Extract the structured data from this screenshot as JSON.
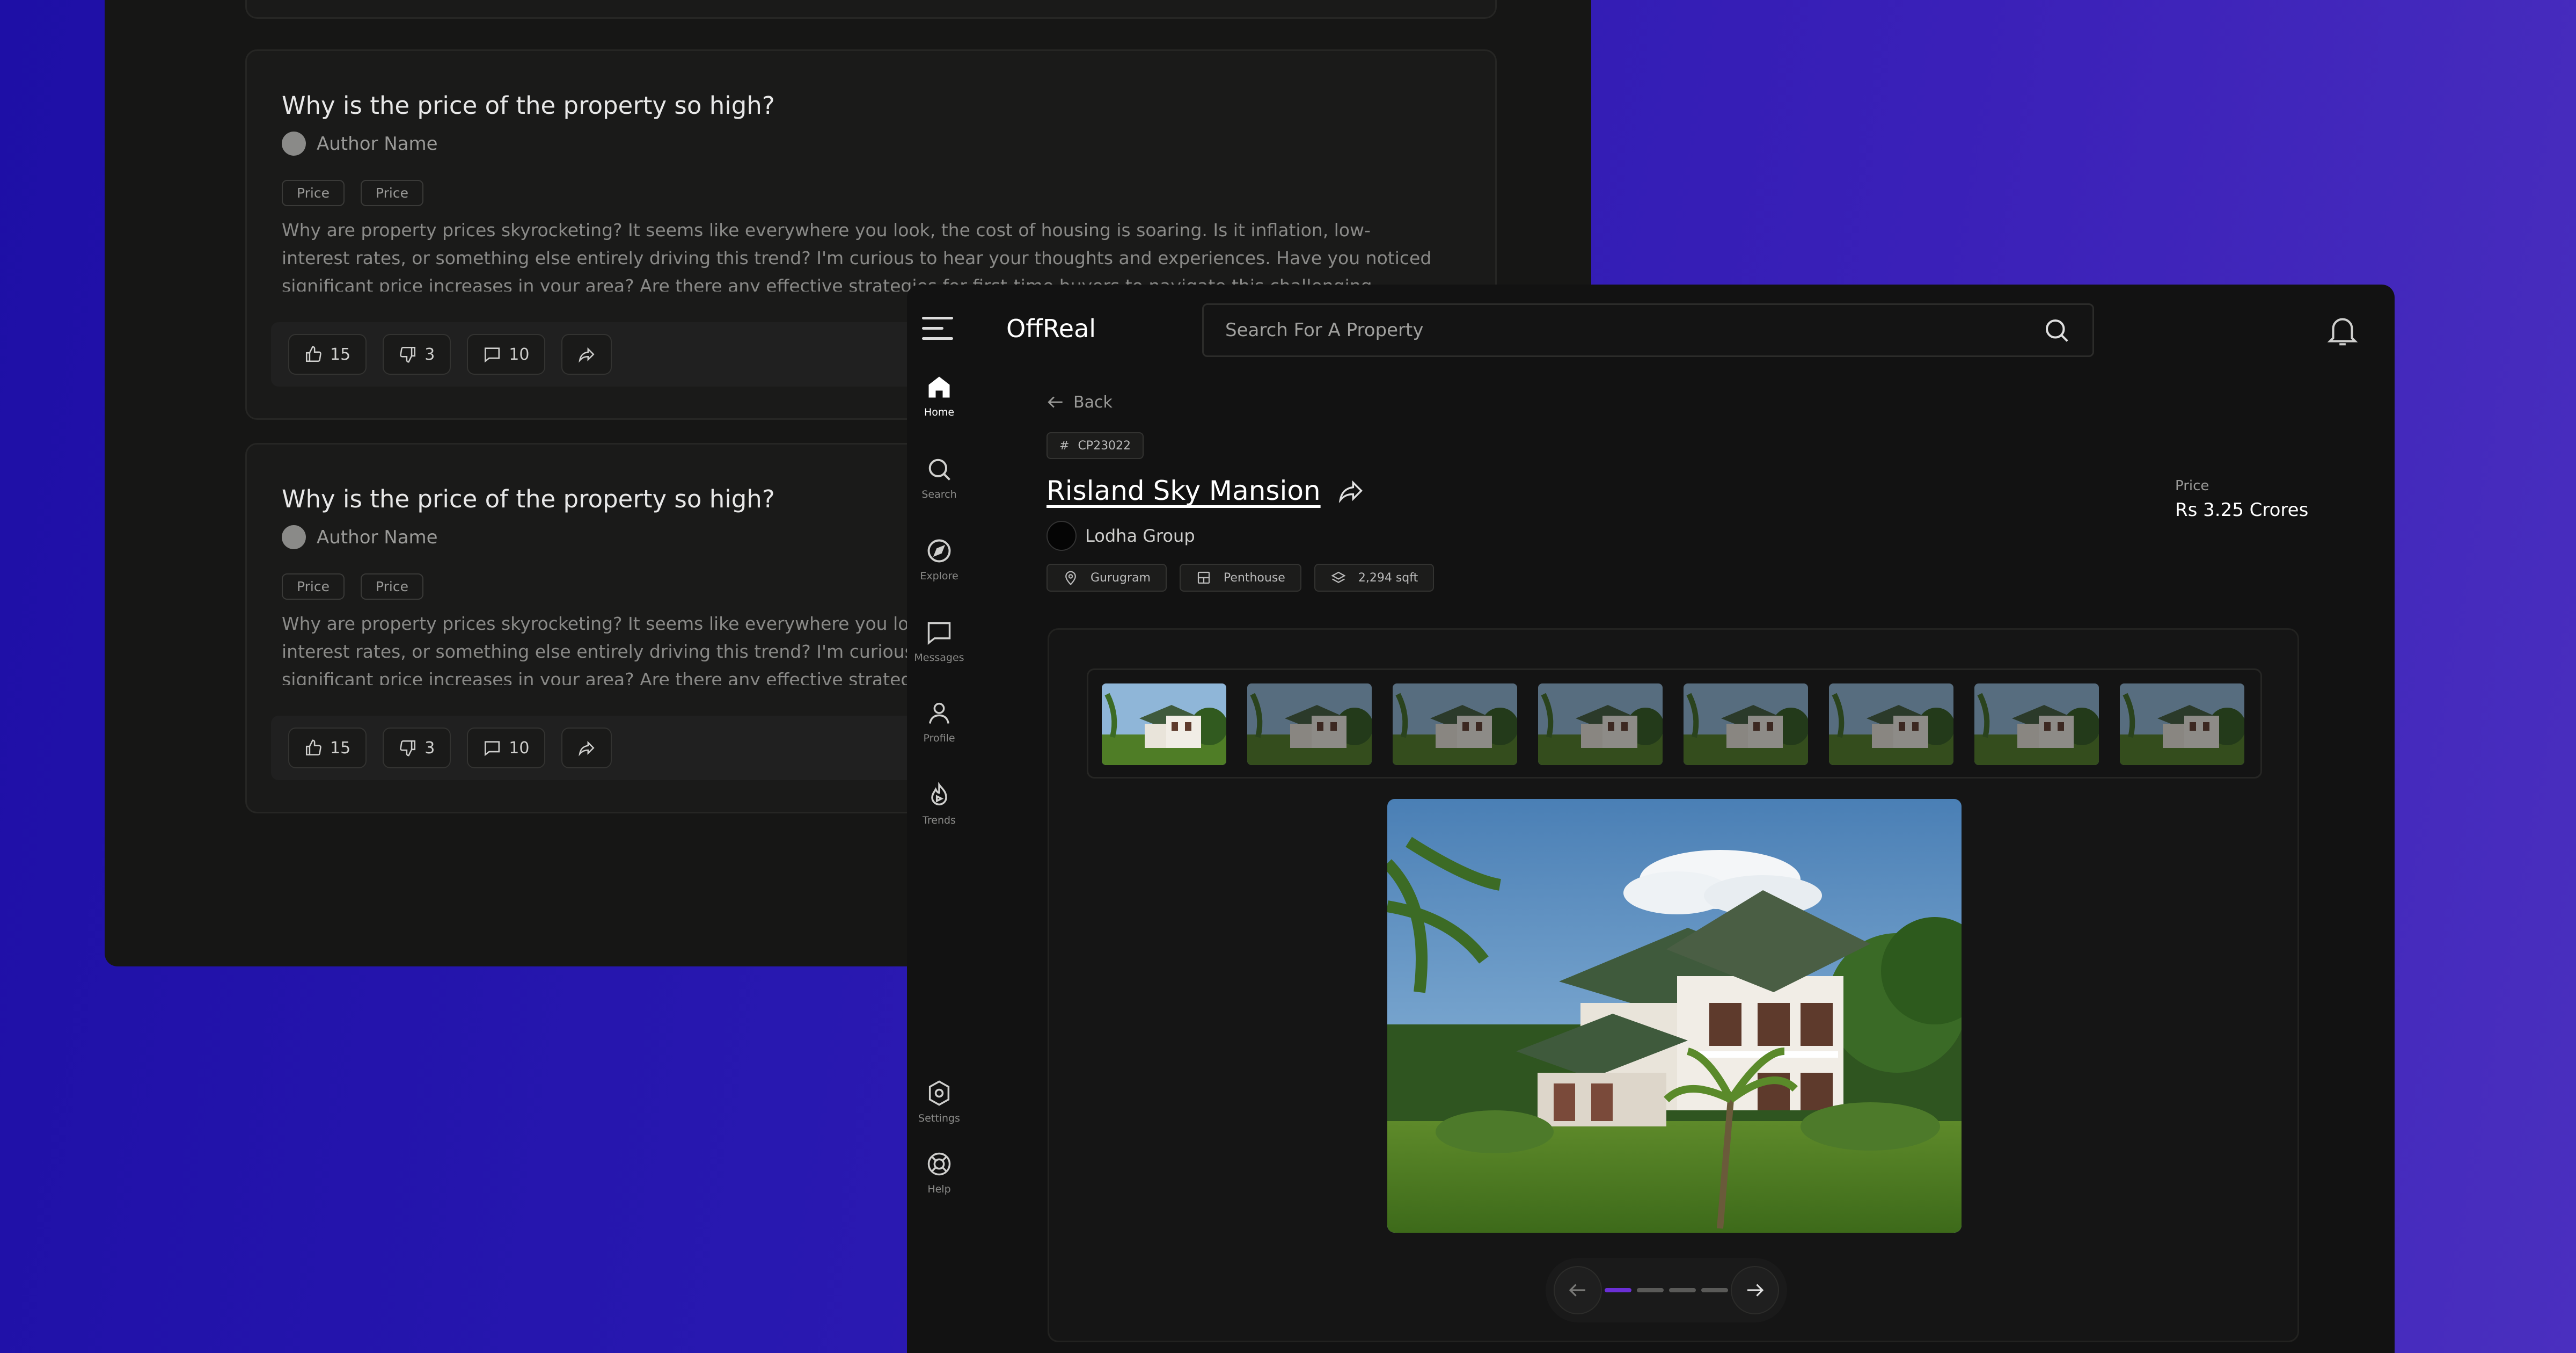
{
  "forum": {
    "posts": [
      {
        "title": "Why is the price of the property so high?",
        "author": "Author Name",
        "tags": [
          "Price",
          "Price"
        ],
        "body": "Why are property prices skyrocketing? It seems like everywhere you look, the cost of housing is soaring. Is it inflation, low-interest rates, or something else entirely driving this trend? I'm curious to hear your thoughts and experiences. Have you noticed significant price increases in your area? Are there any effective strategies for first-time buyers to navigate this challenging market?",
        "likes": "15",
        "dislikes": "3",
        "comments": "10"
      },
      {
        "title": "Why is the price of the property so high?",
        "author": "Author Name",
        "tags": [
          "Price",
          "Price"
        ],
        "body": "Why are property prices skyrocketing? It seems like everywhere you look, the cost of housing is soaring. Is it inflation, low-interest rates, or something else entirely driving this trend? I'm curious to hear your thoughts and experiences. Have you noticed significant price increases in your area? Are there any effective strategies for first-time buyers to navigate this challenging market?",
        "likes": "15",
        "dislikes": "3",
        "comments": "10"
      }
    ]
  },
  "app": {
    "brand": "OffReal",
    "search": {
      "placeholder": "Search For A Property",
      "value": ""
    },
    "nav": [
      {
        "label": "Home",
        "icon": "home-icon",
        "active": true
      },
      {
        "label": "Search",
        "icon": "search-icon"
      },
      {
        "label": "Explore",
        "icon": "compass-icon"
      },
      {
        "label": "Messages",
        "icon": "message-icon"
      },
      {
        "label": "Profile",
        "icon": "user-icon"
      },
      {
        "label": "Trends",
        "icon": "trends-icon"
      }
    ],
    "nav_bottom": [
      {
        "label": "Settings",
        "icon": "gear-icon"
      },
      {
        "label": "Help",
        "icon": "help-icon"
      }
    ],
    "back_label": "Back",
    "property": {
      "code": "CP23022",
      "title": "Risland Sky Mansion",
      "developer": "Lodha Group",
      "location": "Gurugram",
      "type": "Penthouse",
      "area": "2,294 sqft",
      "price_label": "Price",
      "price": "Rs 3.25 Crores"
    },
    "gallery": {
      "thumbnail_count": 8,
      "selected_thumbnail": 1,
      "carousel_pages": 4,
      "carousel_active": 1
    },
    "colors": {
      "accent": "#6b2fd6",
      "background": "#121212",
      "backdrop_gradient_start": "#1e0fa6",
      "backdrop_gradient_end": "#4a2fbf"
    }
  }
}
